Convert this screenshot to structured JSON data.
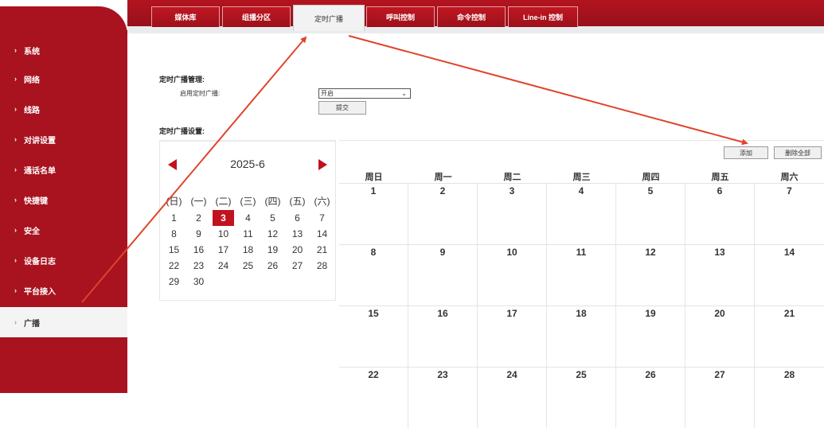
{
  "sidebar": {
    "items": [
      {
        "label": "系统"
      },
      {
        "label": "网络"
      },
      {
        "label": "线路"
      },
      {
        "label": "对讲设置"
      },
      {
        "label": "通话名单"
      },
      {
        "label": "快捷键"
      },
      {
        "label": "安全"
      },
      {
        "label": "设备日志"
      },
      {
        "label": "平台接入"
      },
      {
        "label": "广播",
        "active": true
      }
    ]
  },
  "tabs": [
    {
      "label": "媒体库"
    },
    {
      "label": "组播分区"
    },
    {
      "label": "定时广播",
      "active": true
    },
    {
      "label": "呼叫控制"
    },
    {
      "label": "命令控制"
    },
    {
      "label": "Line-in 控制"
    }
  ],
  "management": {
    "title": "定时广播管理:",
    "enable_label": "启用定时广播:",
    "enable_value": "开启",
    "submit_label": "提交"
  },
  "settings": {
    "title": "定时广播设置:"
  },
  "mini_calendar": {
    "title": "2025-6",
    "weekdays": [
      "(日)",
      "(一)",
      "(二)",
      "(三)",
      "(四)",
      "(五)",
      "(六)"
    ],
    "today": "3"
  },
  "big_calendar": {
    "add_label": "添加",
    "delete_all_label": "删除全部",
    "weekdays": [
      "周日",
      "周一",
      "周二",
      "周三",
      "周四",
      "周五",
      "周六"
    ],
    "rows": [
      [
        "1",
        "2",
        "3",
        "4",
        "5",
        "6",
        "7"
      ],
      [
        "8",
        "9",
        "10",
        "11",
        "12",
        "13",
        "14"
      ],
      [
        "15",
        "16",
        "17",
        "18",
        "19",
        "20",
        "21"
      ],
      [
        "22",
        "23",
        "24",
        "25",
        "26",
        "27",
        "28"
      ]
    ]
  },
  "colors": {
    "brand_red": "#a8131f",
    "today_red": "#c1121f",
    "arrow_red": "#e0442a"
  }
}
